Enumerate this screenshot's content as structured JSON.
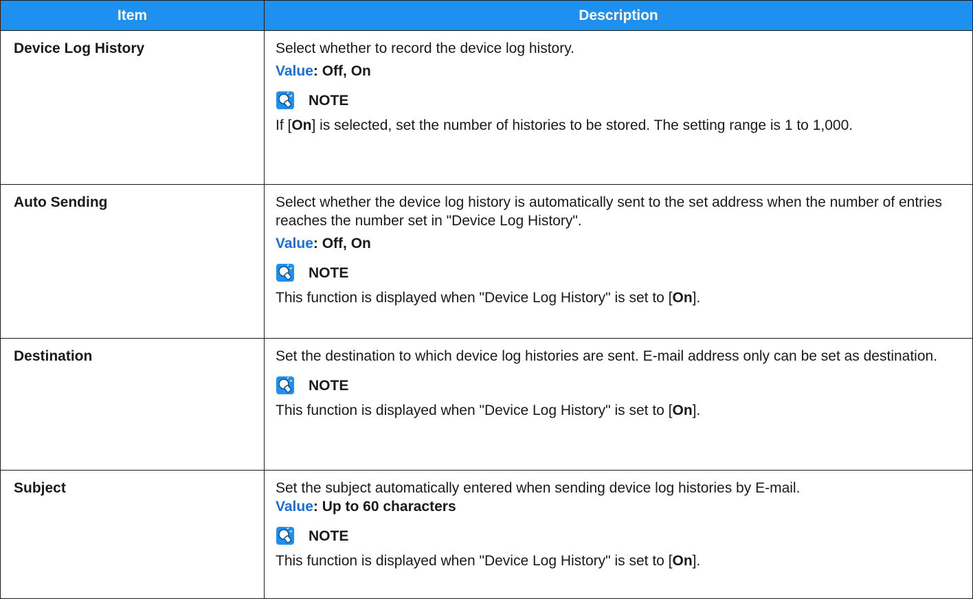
{
  "table": {
    "headers": {
      "item": "Item",
      "description": "Description"
    },
    "rows": [
      {
        "item": "Device Log History",
        "desc": "Select whether to record the device log history.",
        "value_label": "Value",
        "value_text": ": Off, On",
        "note_title": "NOTE",
        "note_pre": "If [",
        "note_bold": "On",
        "note_post": "] is selected, set the number of histories to be stored. The setting range is 1 to 1,000."
      },
      {
        "item": "Auto Sending",
        "desc": "Select whether the device log history is automatically sent to the set address when the number of entries reaches the number set in \"Device Log History\".",
        "value_label": "Value",
        "value_text": ": Off, On",
        "note_title": "NOTE",
        "note_pre": "This function is displayed when \"Device Log History\" is set to [",
        "note_bold": "On",
        "note_post": "]."
      },
      {
        "item": "Destination",
        "desc": "Set the destination to which device log histories are sent. E-mail address only can be set as destination.",
        "note_title": "NOTE",
        "note_pre": "This function is displayed when \"Device Log History\" is set to [",
        "note_bold": "On",
        "note_post": "]."
      },
      {
        "item": "Subject",
        "desc": "Set the subject automatically entered when sending device log histories by E-mail.",
        "value_label": "Value",
        "value_text": ": Up to 60 characters",
        "note_title": "NOTE",
        "note_pre": "This function is displayed when \"Device Log History\" is set to [",
        "note_bold": "On",
        "note_post": "]."
      }
    ]
  },
  "colors": {
    "header_bg": "#1e90f0",
    "value_label": "#1a6fe0",
    "border": "#1a1a1a"
  },
  "icons": {
    "note": "lightbulb-note-icon"
  }
}
